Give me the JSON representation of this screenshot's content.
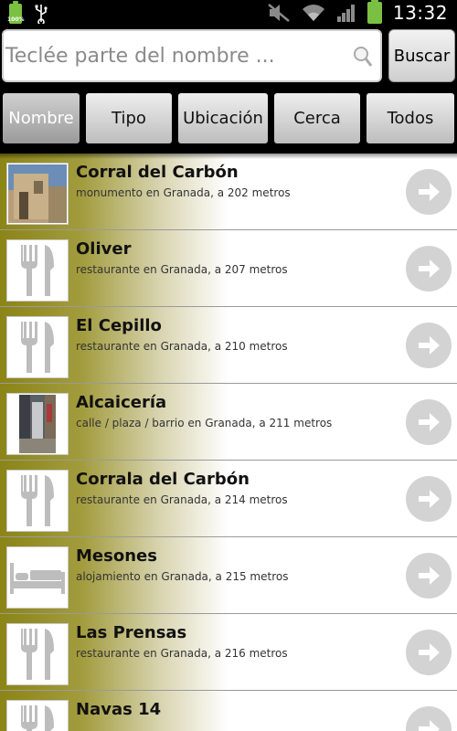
{
  "status_bar": {
    "battery_percent": "100%",
    "time": "13:32"
  },
  "search": {
    "placeholder": "Teclée parte del nombre ...",
    "value": "",
    "button_label": "Buscar"
  },
  "filters": [
    {
      "label": "Nombre",
      "active": true
    },
    {
      "label": "Tipo",
      "active": false
    },
    {
      "label": "Ubicación",
      "active": false
    },
    {
      "label": "Cerca",
      "active": false
    },
    {
      "label": "Todos",
      "active": false
    }
  ],
  "places": [
    {
      "name": "Corral del Carbón",
      "detail": "monumento en Granada, a 202 metros",
      "thumb": "photo-monument"
    },
    {
      "name": "Oliver",
      "detail": "restaurante en Granada, a 207 metros",
      "thumb": "fork-knife-icon"
    },
    {
      "name": "El Cepillo",
      "detail": "restaurante en Granada, a 210 metros",
      "thumb": "fork-knife-icon"
    },
    {
      "name": "Alcaicería",
      "detail": "calle / plaza / barrio en Granada, a 211 metros",
      "thumb": "photo-street"
    },
    {
      "name": "Corrala del Carbón",
      "detail": "restaurante en Granada, a 214 metros",
      "thumb": "fork-knife-icon"
    },
    {
      "name": "Mesones",
      "detail": "alojamiento en Granada, a 215 metros",
      "thumb": "bed-icon"
    },
    {
      "name": "Las Prensas",
      "detail": "restaurante en Granada, a 216 metros",
      "thumb": "fork-knife-icon"
    },
    {
      "name": "Navas 14",
      "detail": "",
      "thumb": "fork-knife-icon"
    }
  ],
  "colors": {
    "row_gradient_start": "#8b8416",
    "arrow_circle": "#d3d3d3",
    "battery": "#7ac143"
  }
}
